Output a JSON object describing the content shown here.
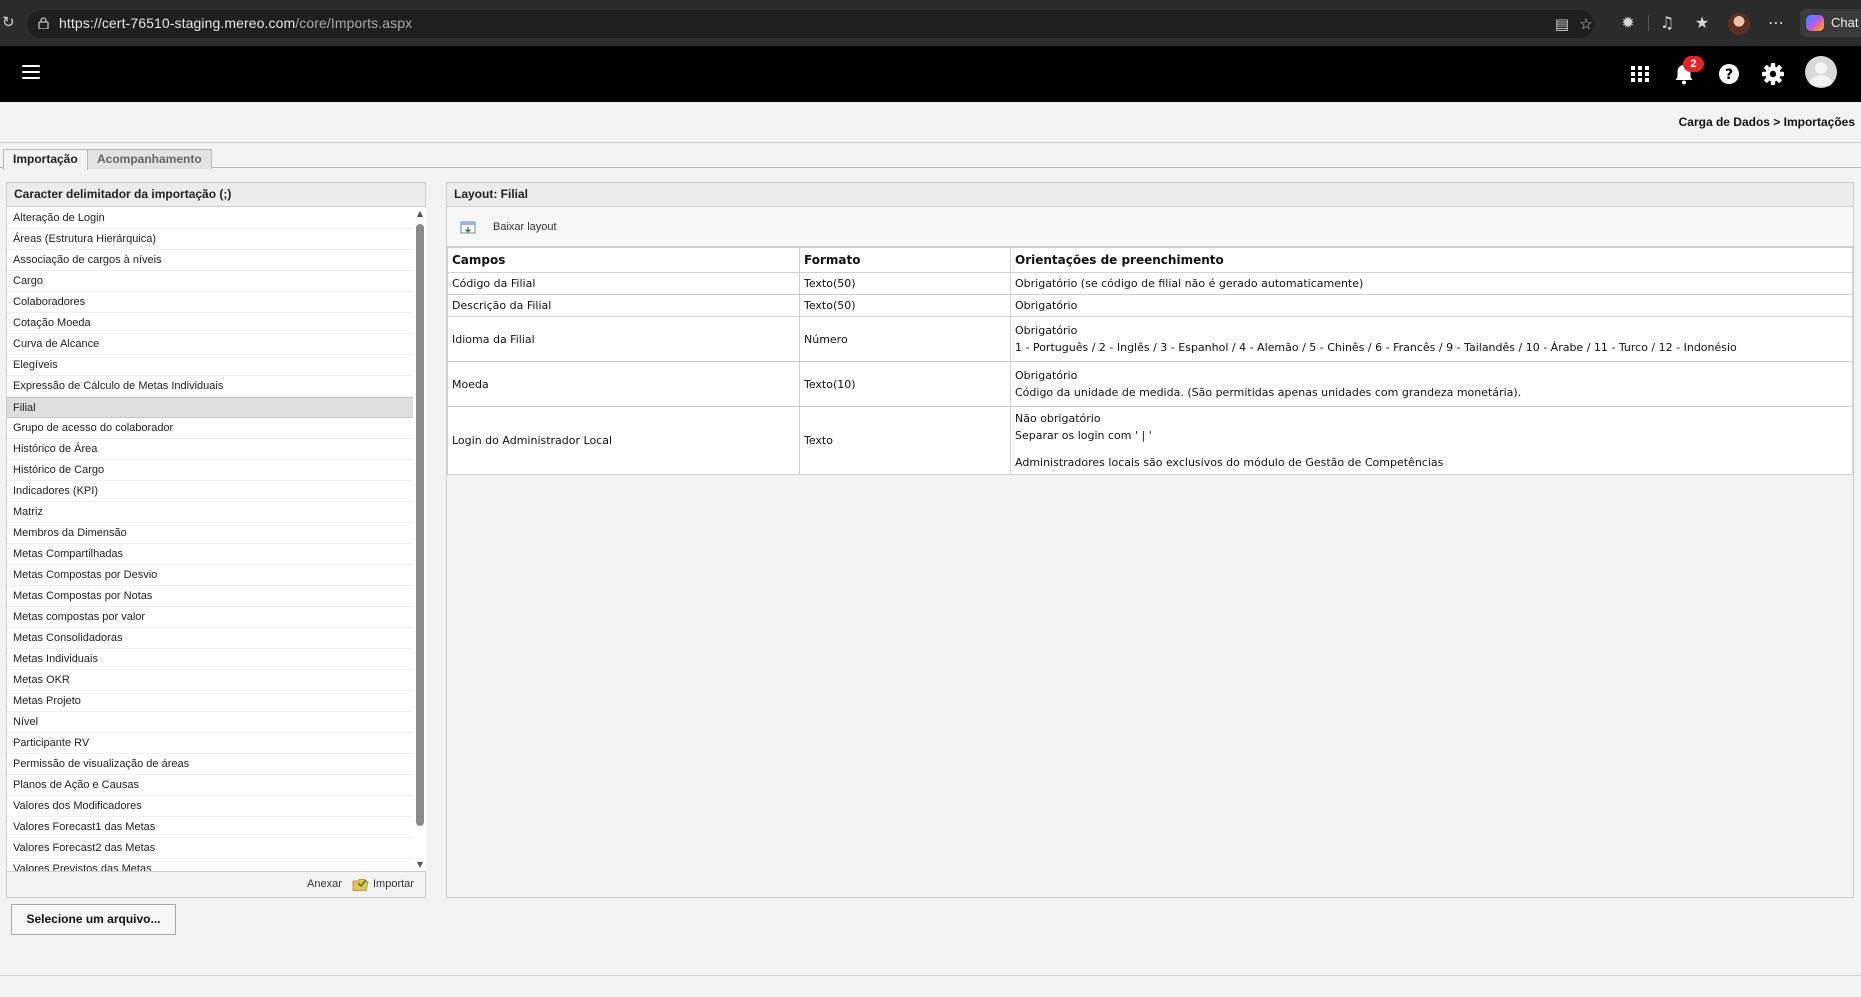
{
  "browser": {
    "url_host": "https://cert-76510-staging.mereo.com",
    "url_path": "/core/Imports.aspx",
    "chat_label": "Chat"
  },
  "header": {
    "notification_count": "2"
  },
  "breadcrumb": "Carga de Dados > Importações",
  "tabs": [
    {
      "label": "Importação",
      "active": true
    },
    {
      "label": "Acompanhamento",
      "active": false
    }
  ],
  "left_panel": {
    "title": "Caracter delimitador da importação (;)",
    "items": [
      "Alteração de Login",
      "Áreas (Estrutura Hierárquica)",
      "Associação de cargos à níveis",
      "Cargo",
      "Colaboradores",
      "Cotação Moeda",
      "Curva de Alcance",
      "Elegíveis",
      "Expressão de Cálculo de Metas Individuais",
      "Filial",
      "Grupo de acesso do colaborador",
      "Histórico de Área",
      "Histórico de Cargo",
      "Indicadores (KPI)",
      "Matriz",
      "Membros da Dimensão",
      "Metas Compartilhadas",
      "Metas Compostas por Desvio",
      "Metas Compostas por Notas",
      "Metas compostas por valor",
      "Metas Consolidadoras",
      "Metas Individuais",
      "Metas OKR",
      "Metas Projeto",
      "Nível",
      "Participante RV",
      "Permissão de visualização de áreas",
      "Planos de Ação e Causas",
      "Valores dos Modificadores",
      "Valores Forecast1 das Metas",
      "Valores Forecast2 das Metas",
      "Valores Previstos das Metas"
    ],
    "selected_item": "Filial",
    "anexar_label": "Anexar",
    "importar_label": "Importar"
  },
  "select_file_label": "Selecione um arquivo...",
  "right_panel": {
    "title": "Layout: Filial",
    "download_label": "Baixar layout",
    "columns": [
      "Campos",
      "Formato",
      "Orientações de preenchimento"
    ],
    "rows": [
      {
        "campo": "Código da Filial",
        "formato": "Texto(50)",
        "orientacoes": [
          "Obrigatório (se código de filial não é gerado automaticamente)"
        ]
      },
      {
        "campo": "Descrição da Filial",
        "formato": "Texto(50)",
        "orientacoes": [
          "Obrigatório"
        ]
      },
      {
        "campo": "Idioma da Filial",
        "formato": "Número",
        "orientacoes": [
          "Obrigatório",
          "1 - Português / 2 - Inglês / 3 - Espanhol / 4 - Alemão / 5 - Chinês / 6 - Francês / 9 - Tailandês / 10 - Árabe / 11 - Turco / 12 - Indonésio"
        ]
      },
      {
        "campo": "Moeda",
        "formato": "Texto(10)",
        "orientacoes": [
          "Obrigatório",
          "Código da unidade de medida. (São permitidas apenas unidades com grandeza monetária)."
        ]
      },
      {
        "campo": "Login do Administrador Local",
        "formato": "Texto",
        "orientacoes": [
          "Não obrigatório",
          "Separar os login com ' | '",
          "",
          "Administradores locais são exclusivos do módulo de Gestão de Competências"
        ]
      }
    ]
  }
}
